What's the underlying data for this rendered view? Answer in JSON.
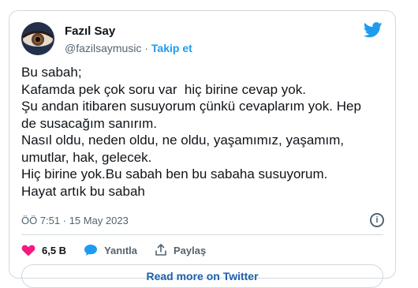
{
  "author": {
    "name": "Fazıl Say",
    "handle": "@fazilsaymusic",
    "separator": "·",
    "follow_label": "Takip et"
  },
  "tweet": {
    "lines": [
      "Bu sabah;",
      "Kafamda pek çok soru var  hiç birine cevap yok.",
      "Şu andan itibaren susuyorum çünkü cevaplarım yok. Hep",
      "de susacağım sanırım.",
      "Nasıl oldu, neden oldu, ne oldu, yaşamımız, yaşamım,",
      "umutlar, hak, gelecek.",
      "Hiç birine yok.Bu sabah ben bu sabaha susuyorum.",
      "Hayat artık bu sabah"
    ],
    "timestamp": "ÖÖ 7:51 · 15 May 2023",
    "info_icon_label": "i"
  },
  "actions": {
    "likes": "6,5 B",
    "reply_label": "Yanıtla",
    "share_label": "Paylaş"
  },
  "read_more_label": "Read more on Twitter",
  "colors": {
    "accent": "#1d9bf0",
    "like": "#f91880",
    "border": "#cfd9de",
    "muted": "#536471"
  }
}
